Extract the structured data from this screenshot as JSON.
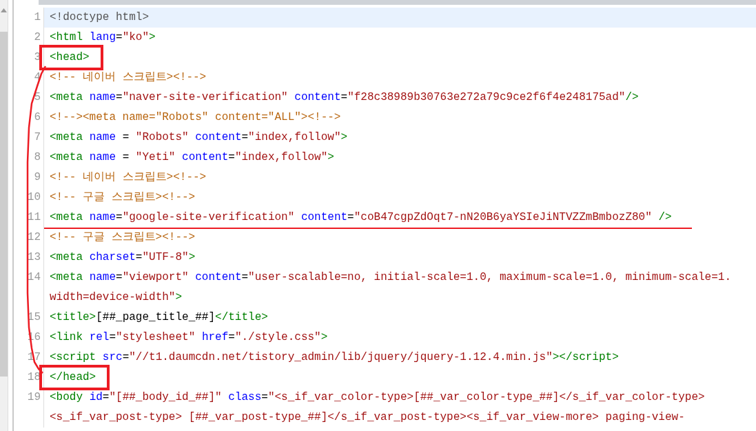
{
  "editor": {
    "lines": [
      {
        "number": "1",
        "current": true,
        "boxed": false,
        "underlined": false,
        "rows": [
          [
            {
              "kind": "doctype",
              "text": "<!doctype html>"
            }
          ]
        ]
      },
      {
        "number": "2",
        "current": false,
        "boxed": false,
        "underlined": false,
        "rows": [
          [
            {
              "kind": "tag",
              "text": "<html"
            },
            {
              "kind": "plain",
              "text": " "
            },
            {
              "kind": "attr",
              "text": "lang"
            },
            {
              "kind": "plain",
              "text": "="
            },
            {
              "kind": "value",
              "text": "\"ko\""
            },
            {
              "kind": "tag",
              "text": ">"
            }
          ]
        ]
      },
      {
        "number": "3",
        "current": false,
        "boxed": true,
        "underlined": false,
        "rows": [
          [
            {
              "kind": "tag",
              "text": "<head>"
            }
          ]
        ]
      },
      {
        "number": "4",
        "current": false,
        "boxed": false,
        "underlined": false,
        "rows": [
          [
            {
              "kind": "comment",
              "text": "<!-- 네이버 스크립트><!-->"
            }
          ]
        ]
      },
      {
        "number": "5",
        "current": false,
        "boxed": false,
        "underlined": false,
        "rows": [
          [
            {
              "kind": "tag",
              "text": "<meta"
            },
            {
              "kind": "plain",
              "text": " "
            },
            {
              "kind": "attr",
              "text": "name"
            },
            {
              "kind": "plain",
              "text": "="
            },
            {
              "kind": "value",
              "text": "\"naver-site-verification\""
            },
            {
              "kind": "plain",
              "text": " "
            },
            {
              "kind": "attr",
              "text": "content"
            },
            {
              "kind": "plain",
              "text": "="
            },
            {
              "kind": "value",
              "text": "\"f28c38989b30763e272a79c9ce2f6f4e248175ad\""
            },
            {
              "kind": "tag",
              "text": "/>"
            }
          ]
        ]
      },
      {
        "number": "6",
        "current": false,
        "boxed": false,
        "underlined": false,
        "rows": [
          [
            {
              "kind": "comment",
              "text": "<!--><meta name=\"Robots\" content=\"ALL\"><!-->"
            }
          ]
        ]
      },
      {
        "number": "7",
        "current": false,
        "boxed": false,
        "underlined": false,
        "rows": [
          [
            {
              "kind": "tag",
              "text": "<meta"
            },
            {
              "kind": "plain",
              "text": " "
            },
            {
              "kind": "attr",
              "text": "name"
            },
            {
              "kind": "plain",
              "text": " = "
            },
            {
              "kind": "value",
              "text": "\"Robots\""
            },
            {
              "kind": "plain",
              "text": " "
            },
            {
              "kind": "attr",
              "text": "content"
            },
            {
              "kind": "plain",
              "text": "="
            },
            {
              "kind": "value",
              "text": "\"index,follow\""
            },
            {
              "kind": "tag",
              "text": ">"
            }
          ]
        ]
      },
      {
        "number": "8",
        "current": false,
        "boxed": false,
        "underlined": false,
        "rows": [
          [
            {
              "kind": "tag",
              "text": "<meta"
            },
            {
              "kind": "plain",
              "text": " "
            },
            {
              "kind": "attr",
              "text": "name"
            },
            {
              "kind": "plain",
              "text": " = "
            },
            {
              "kind": "value",
              "text": "\"Yeti\""
            },
            {
              "kind": "plain",
              "text": " "
            },
            {
              "kind": "attr",
              "text": "content"
            },
            {
              "kind": "plain",
              "text": "="
            },
            {
              "kind": "value",
              "text": "\"index,follow\""
            },
            {
              "kind": "tag",
              "text": ">"
            }
          ]
        ]
      },
      {
        "number": "9",
        "current": false,
        "boxed": false,
        "underlined": false,
        "rows": [
          [
            {
              "kind": "comment",
              "text": "<!-- 네이버 스크립트><!-->"
            }
          ]
        ]
      },
      {
        "number": "10",
        "current": false,
        "boxed": false,
        "underlined": false,
        "rows": [
          [
            {
              "kind": "comment",
              "text": "<!-- 구글 스크립트><!-->"
            }
          ]
        ]
      },
      {
        "number": "11",
        "current": false,
        "boxed": false,
        "underlined": true,
        "rows": [
          [
            {
              "kind": "tag",
              "text": "<meta"
            },
            {
              "kind": "plain",
              "text": " "
            },
            {
              "kind": "attr",
              "text": "name"
            },
            {
              "kind": "plain",
              "text": "="
            },
            {
              "kind": "value",
              "text": "\"google-site-verification\""
            },
            {
              "kind": "plain",
              "text": " "
            },
            {
              "kind": "attr",
              "text": "content"
            },
            {
              "kind": "plain",
              "text": "="
            },
            {
              "kind": "value",
              "text": "\"coB47cgpZdOqt7-nN20B6yaYSIeJiNTVZZmBmbozZ80\""
            },
            {
              "kind": "plain",
              "text": " "
            },
            {
              "kind": "tag",
              "text": "/>"
            }
          ]
        ]
      },
      {
        "number": "12",
        "current": false,
        "boxed": false,
        "underlined": false,
        "rows": [
          [
            {
              "kind": "comment",
              "text": "<!-- 구글 스크립트><!-->"
            }
          ]
        ]
      },
      {
        "number": "13",
        "current": false,
        "boxed": false,
        "underlined": false,
        "rows": [
          [
            {
              "kind": "tag",
              "text": "<meta"
            },
            {
              "kind": "plain",
              "text": " "
            },
            {
              "kind": "attr",
              "text": "charset"
            },
            {
              "kind": "plain",
              "text": "="
            },
            {
              "kind": "value",
              "text": "\"UTF-8\""
            },
            {
              "kind": "tag",
              "text": ">"
            }
          ]
        ]
      },
      {
        "number": "14",
        "current": false,
        "boxed": false,
        "underlined": false,
        "rows": [
          [
            {
              "kind": "tag",
              "text": "<meta"
            },
            {
              "kind": "plain",
              "text": " "
            },
            {
              "kind": "attr",
              "text": "name"
            },
            {
              "kind": "plain",
              "text": "="
            },
            {
              "kind": "value",
              "text": "\"viewport\""
            },
            {
              "kind": "plain",
              "text": " "
            },
            {
              "kind": "attr",
              "text": "content"
            },
            {
              "kind": "plain",
              "text": "="
            },
            {
              "kind": "value",
              "text": "\"user-scalable=no, initial-scale=1.0, maximum-scale=1.0, minimum-scale=1."
            }
          ],
          [
            {
              "kind": "value",
              "text": "width=device-width\""
            },
            {
              "kind": "tag",
              "text": ">"
            }
          ]
        ]
      },
      {
        "number": "15",
        "current": false,
        "boxed": false,
        "underlined": false,
        "rows": [
          [
            {
              "kind": "tag",
              "text": "<title>"
            },
            {
              "kind": "plain",
              "text": "[##_page_title_##]"
            },
            {
              "kind": "tag",
              "text": "</title>"
            }
          ]
        ]
      },
      {
        "number": "16",
        "current": false,
        "boxed": false,
        "underlined": false,
        "rows": [
          [
            {
              "kind": "tag",
              "text": "<link"
            },
            {
              "kind": "plain",
              "text": " "
            },
            {
              "kind": "attr",
              "text": "rel"
            },
            {
              "kind": "plain",
              "text": "="
            },
            {
              "kind": "value",
              "text": "\"stylesheet\""
            },
            {
              "kind": "plain",
              "text": " "
            },
            {
              "kind": "attr",
              "text": "href"
            },
            {
              "kind": "plain",
              "text": "="
            },
            {
              "kind": "value",
              "text": "\"./style.css\""
            },
            {
              "kind": "tag",
              "text": ">"
            }
          ]
        ]
      },
      {
        "number": "17",
        "current": false,
        "boxed": false,
        "underlined": false,
        "rows": [
          [
            {
              "kind": "tag",
              "text": "<script"
            },
            {
              "kind": "plain",
              "text": " "
            },
            {
              "kind": "attr",
              "text": "src"
            },
            {
              "kind": "plain",
              "text": "="
            },
            {
              "kind": "value",
              "text": "\"//t1.daumcdn.net/tistory_admin/lib/jquery/jquery-1.12.4.min.js\""
            },
            {
              "kind": "tag",
              "text": "></script>"
            }
          ]
        ]
      },
      {
        "number": "18",
        "current": false,
        "boxed": true,
        "underlined": false,
        "rows": [
          [
            {
              "kind": "tag",
              "text": "</head>"
            }
          ]
        ]
      },
      {
        "number": "19",
        "current": false,
        "boxed": false,
        "underlined": false,
        "rows": [
          [
            {
              "kind": "tag",
              "text": "<body"
            },
            {
              "kind": "plain",
              "text": " "
            },
            {
              "kind": "attr",
              "text": "id"
            },
            {
              "kind": "plain",
              "text": "="
            },
            {
              "kind": "value",
              "text": "\"[##_body_id_##]\""
            },
            {
              "kind": "plain",
              "text": " "
            },
            {
              "kind": "attr",
              "text": "class"
            },
            {
              "kind": "plain",
              "text": "="
            },
            {
              "kind": "value",
              "text": "\"<s_if_var_color-type>[##_var_color-type_##]</s_if_var_color-type>"
            }
          ],
          [
            {
              "kind": "value",
              "text": "<s_if_var_post-type> [##_var_post-type_##]</s_if_var_post-type><s_if_var_view-more> paging-view-"
            }
          ]
        ]
      }
    ]
  }
}
